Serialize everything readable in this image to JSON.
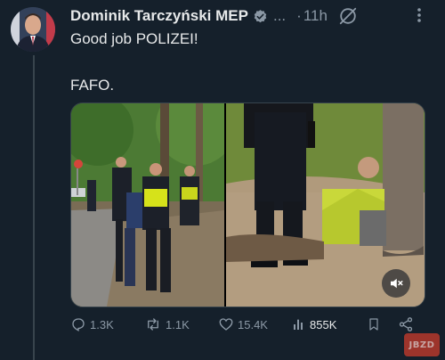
{
  "post": {
    "author_name": "Dominik Tarczyński MEP",
    "overflow_dots": "...",
    "separator": "·",
    "timestamp": "11h",
    "text_line1": "Good job POLIZEI!",
    "text_line2": "FAFO."
  },
  "actions": {
    "replies": "1.3K",
    "reposts": "1.1K",
    "likes": "15.4K",
    "views": "855K"
  },
  "watermark": {
    "text": "JBZD"
  },
  "colors": {
    "background": "#15202b",
    "text": "#e7e9ea",
    "muted": "#8b98a5",
    "verified": "#1d9bf0"
  },
  "icons": [
    "verified-badge-icon",
    "grok-icon",
    "more-icon",
    "mute-icon",
    "reply-icon",
    "repost-icon",
    "like-icon",
    "views-icon",
    "bookmark-icon",
    "share-icon"
  ]
}
